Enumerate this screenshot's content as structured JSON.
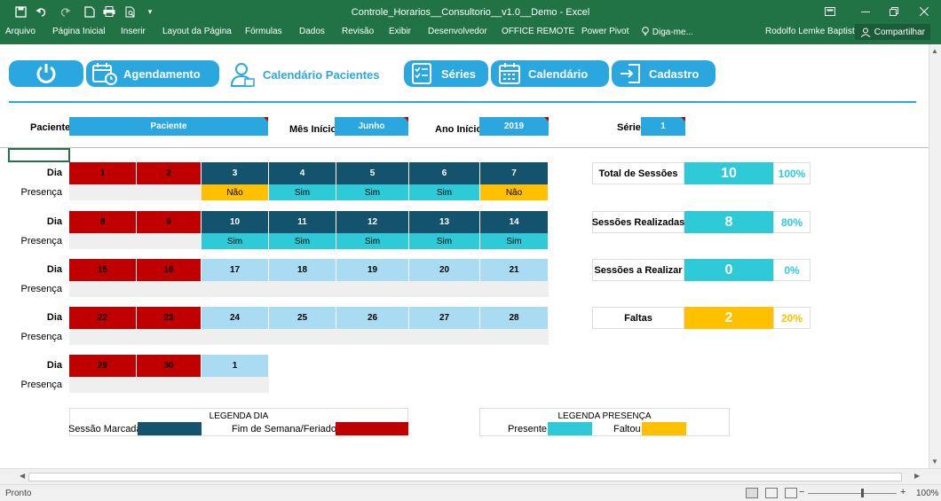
{
  "window": {
    "title": "Controle_Horarios__Consultorio__v1.0__Demo - Excel",
    "user": "Rodolfo Lemke Baptista",
    "share_label": "Compartilhar"
  },
  "ribbon_tabs": [
    "Arquivo",
    "Página Inicial",
    "Inserir",
    "Layout da Página",
    "Fórmulas",
    "Dados",
    "Revisão",
    "Exibir",
    "Desenvolvedor",
    "OFFICE REMOTE",
    "Power Pivot",
    "Diga-me..."
  ],
  "nav": {
    "agendamento": "Agendamento",
    "calendario_pacientes": "Calendário Pacientes",
    "series": "Séries",
    "calendario": "Calendário",
    "cadastro": "Cadastro"
  },
  "params": {
    "paciente_label": "Paciente",
    "paciente_value": "Paciente",
    "mes_label": "Mês Início",
    "mes_value": "Junho",
    "ano_label": "Ano Início",
    "ano_value": "2019",
    "serie_label": "Série",
    "serie_value": "1"
  },
  "labels": {
    "dia": "Dia",
    "presenca": "Presença"
  },
  "colors": {
    "sessao": "#14536e",
    "feriado": "#c00000",
    "livre": "#a9dcf2",
    "presente": "#2ecad8",
    "faltou": "#ffc000",
    "accent": "#2aa7de"
  },
  "calendar": {
    "weeks": [
      {
        "days": [
          {
            "n": "1",
            "t": "feriado"
          },
          {
            "n": "2",
            "t": "feriado"
          },
          {
            "n": "3",
            "t": "sessao"
          },
          {
            "n": "4",
            "t": "sessao"
          },
          {
            "n": "5",
            "t": "sessao"
          },
          {
            "n": "6",
            "t": "sessao"
          },
          {
            "n": "7",
            "t": "sessao"
          }
        ],
        "presence": [
          "",
          "",
          "Não",
          "Sim",
          "Sim",
          "Sim",
          "Não"
        ]
      },
      {
        "days": [
          {
            "n": "8",
            "t": "feriado"
          },
          {
            "n": "9",
            "t": "feriado"
          },
          {
            "n": "10",
            "t": "sessao"
          },
          {
            "n": "11",
            "t": "sessao"
          },
          {
            "n": "12",
            "t": "sessao"
          },
          {
            "n": "13",
            "t": "sessao"
          },
          {
            "n": "14",
            "t": "sessao"
          }
        ],
        "presence": [
          "",
          "",
          "Sim",
          "Sim",
          "Sim",
          "Sim",
          "Sim"
        ]
      },
      {
        "days": [
          {
            "n": "15",
            "t": "feriado"
          },
          {
            "n": "16",
            "t": "feriado"
          },
          {
            "n": "17",
            "t": "livre"
          },
          {
            "n": "18",
            "t": "livre"
          },
          {
            "n": "19",
            "t": "livre"
          },
          {
            "n": "20",
            "t": "livre"
          },
          {
            "n": "21",
            "t": "livre"
          }
        ],
        "presence": [
          "",
          "",
          "",
          "",
          "",
          "",
          ""
        ]
      },
      {
        "days": [
          {
            "n": "22",
            "t": "feriado"
          },
          {
            "n": "23",
            "t": "feriado"
          },
          {
            "n": "24",
            "t": "livre"
          },
          {
            "n": "25",
            "t": "livre"
          },
          {
            "n": "26",
            "t": "livre"
          },
          {
            "n": "27",
            "t": "livre"
          },
          {
            "n": "28",
            "t": "livre"
          }
        ],
        "presence": [
          "",
          "",
          "",
          "",
          "",
          "",
          ""
        ]
      },
      {
        "days": [
          {
            "n": "29",
            "t": "feriado"
          },
          {
            "n": "30",
            "t": "feriado"
          },
          {
            "n": "1",
            "t": "livre"
          }
        ],
        "presence": [
          "",
          "",
          ""
        ]
      }
    ]
  },
  "stats": [
    {
      "label": "Total de Sessões",
      "value": "10",
      "pct": "100%",
      "kind": "presente"
    },
    {
      "label": "Sessões Realizadas",
      "value": "8",
      "pct": "80%",
      "kind": "presente"
    },
    {
      "label": "Sessões a Realizar",
      "value": "0",
      "pct": "0%",
      "kind": "presente"
    },
    {
      "label": "Faltas",
      "value": "2",
      "pct": "20%",
      "kind": "faltou"
    }
  ],
  "legend_dia": {
    "title": "LEGENDA DIA",
    "sessao": "Sessão Marcada",
    "feriado": "Fim de Semana/Feriado"
  },
  "legend_presenca": {
    "title": "LEGENDA PRESENÇA",
    "presente": "Presente",
    "faltou": "Faltou"
  },
  "status": {
    "ready": "Pronto",
    "zoom": "100%"
  }
}
